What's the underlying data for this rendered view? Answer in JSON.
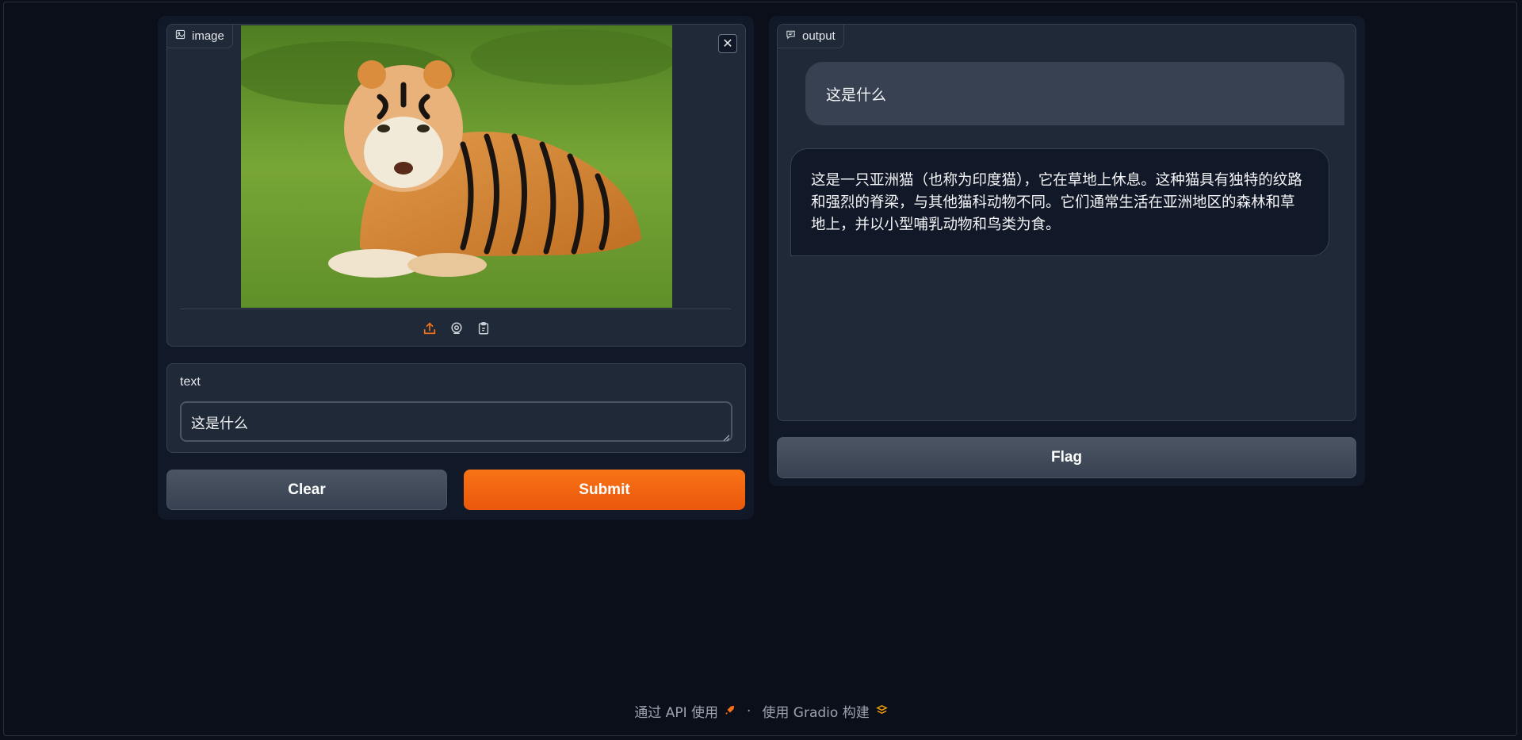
{
  "inputs": {
    "image_label": "image",
    "text_label": "text",
    "text_value": "这是什么"
  },
  "buttons": {
    "clear": "Clear",
    "submit": "Submit",
    "flag": "Flag"
  },
  "output": {
    "label": "output",
    "messages": [
      {
        "role": "user",
        "text": "这是什么"
      },
      {
        "role": "bot",
        "text": "这是一只亚洲猫（也称为印度猫），它在草地上休息。这种猫具有独特的纹路和强烈的脊梁，与其他猫科动物不同。它们通常生活在亚洲地区的森林和草地上，并以小型哺乳动物和鸟类为食。"
      }
    ]
  },
  "footer": {
    "api_link": "通过 API 使用",
    "separator": "·",
    "built_with": "使用 Gradio 构建"
  },
  "icons": [
    "image-icon",
    "close-icon",
    "upload-icon",
    "webcam-icon",
    "clipboard-icon",
    "chat-icon",
    "rocket-icon",
    "gradio-logo-icon"
  ],
  "colors": {
    "accent": "#f97316",
    "background": "#0b0f19",
    "panel": "#1f2937"
  }
}
